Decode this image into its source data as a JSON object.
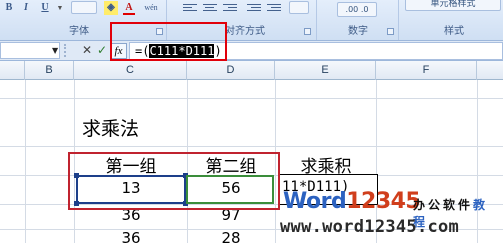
{
  "ribbon": {
    "font_group_label": "字体",
    "align_group_label": "对齐方式",
    "number_group_label": "数字",
    "styles_group_label": "样式",
    "bold_btn": "B",
    "italic_btn": "I",
    "underline_btn": "U",
    "font_color_btn": "A",
    "phonetic_btn": "wén",
    "cell_styles_btn": "单元格样式",
    "decimal_btns": ".00 .0"
  },
  "formula_bar": {
    "name_box_value": "",
    "formula_prefix": "=(",
    "formula_selected": "C111*D111",
    "formula_suffix": ")",
    "cancel_symbol": "✕",
    "enter_symbol": "✓",
    "fx_label": "fx"
  },
  "columns": [
    "B",
    "C",
    "D",
    "E",
    "F"
  ],
  "sheet": {
    "title": "求乘法",
    "headers": [
      "第一组",
      "第二组",
      "求乘积"
    ],
    "rows": [
      {
        "c": "13",
        "d": "56",
        "e": "11*D111)"
      },
      {
        "c": "36",
        "d": "97",
        "e": ""
      },
      {
        "c": "36",
        "d": "28",
        "e": ""
      }
    ]
  },
  "watermark": {
    "brand_word": "Word",
    "brand_num": "12345",
    "cn_a": "办公软件",
    "cn_b": "教程",
    "url": "www.word12345.com"
  },
  "colors": {
    "highlight_red": "#e1000a",
    "active_cell_blue": "#1d3f8a",
    "ref_green": "#3a8d3a",
    "ribbon_bg": "#dbe7f6"
  }
}
